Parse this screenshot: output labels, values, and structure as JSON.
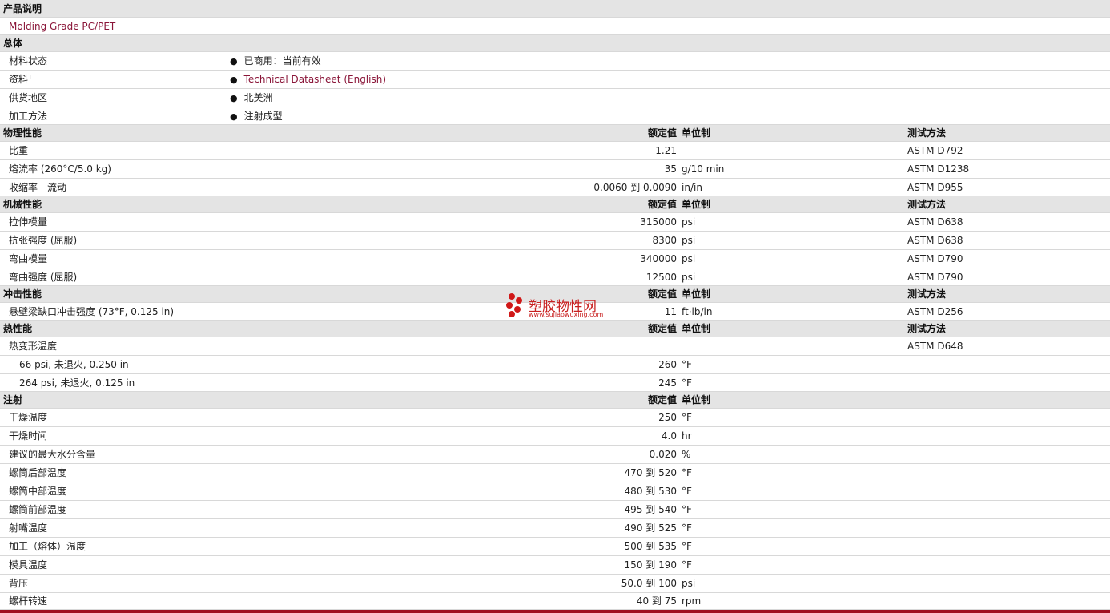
{
  "rows": [
    {
      "t": "h",
      "label": "产品说明"
    },
    {
      "t": "d",
      "label": "Molding Grade PC/PET",
      "cls": "link"
    },
    {
      "t": "h",
      "label": "总体"
    },
    {
      "t": "b",
      "label": "材料状态",
      "bullet": "已商用：当前有效"
    },
    {
      "t": "b",
      "label": "资料",
      "sup": "1",
      "bullet": "Technical Datasheet (English)",
      "bcls": "link"
    },
    {
      "t": "b",
      "label": "供货地区",
      "bullet": "北美洲"
    },
    {
      "t": "b",
      "label": "加工方法",
      "bullet": "注射成型"
    },
    {
      "t": "h",
      "label": "物理性能",
      "val": "额定值",
      "unit": "单位制",
      "test": "测试方法"
    },
    {
      "t": "d",
      "label": "比重",
      "val": "1.21",
      "unit": "",
      "test": "ASTM D792"
    },
    {
      "t": "d",
      "label": "熔流率  (260°C/5.0 kg)",
      "val": "35",
      "unit": "g/10 min",
      "test": "ASTM D1238"
    },
    {
      "t": "d",
      "label": "收缩率  - 流动",
      "val": "0.0060 到  0.0090",
      "unit": "in/in",
      "test": "ASTM D955"
    },
    {
      "t": "h",
      "label": "机械性能",
      "val": "额定值",
      "unit": "单位制",
      "test": "测试方法"
    },
    {
      "t": "d",
      "label": "拉伸模量",
      "val": "315000",
      "unit": "psi",
      "test": "ASTM D638"
    },
    {
      "t": "d",
      "label": "抗张强度  (屈服)",
      "val": "8300",
      "unit": "psi",
      "test": "ASTM D638"
    },
    {
      "t": "d",
      "label": "弯曲模量",
      "val": "340000",
      "unit": "psi",
      "test": "ASTM D790"
    },
    {
      "t": "d",
      "label": "弯曲强度  (屈服)",
      "val": "12500",
      "unit": "psi",
      "test": "ASTM D790"
    },
    {
      "t": "h",
      "label": "冲击性能",
      "val": "额定值",
      "unit": "单位制",
      "test": "测试方法"
    },
    {
      "t": "d",
      "label": "悬壁梁缺口冲击强度  (73°F, 0.125 in)",
      "val": "11",
      "unit": "ft·lb/in",
      "test": "ASTM D256"
    },
    {
      "t": "h",
      "label": "热性能",
      "val": "额定值",
      "unit": "单位制",
      "test": "测试方法"
    },
    {
      "t": "d",
      "label": "热变形温度",
      "val": "",
      "unit": "",
      "test": "ASTM D648"
    },
    {
      "t": "s",
      "label": "66 psi, 未退火, 0.250 in",
      "val": "260",
      "unit": "°F",
      "test": ""
    },
    {
      "t": "s",
      "label": "264 psi, 未退火, 0.125 in",
      "val": "245",
      "unit": "°F",
      "test": ""
    },
    {
      "t": "h",
      "label": "注射",
      "val": "额定值",
      "unit": "单位制",
      "test": ""
    },
    {
      "t": "d",
      "label": "干燥温度",
      "val": "250",
      "unit": "°F",
      "test": ""
    },
    {
      "t": "d",
      "label": "干燥时间",
      "val": "4.0",
      "unit": "hr",
      "test": ""
    },
    {
      "t": "d",
      "label": "建议的最大水分含量",
      "val": "0.020",
      "unit": "%",
      "test": ""
    },
    {
      "t": "d",
      "label": "螺筒后部温度",
      "val": "470 到  520",
      "unit": "°F",
      "test": ""
    },
    {
      "t": "d",
      "label": "螺筒中部温度",
      "val": "480 到  530",
      "unit": "°F",
      "test": ""
    },
    {
      "t": "d",
      "label": "螺筒前部温度",
      "val": "495 到  540",
      "unit": "°F",
      "test": ""
    },
    {
      "t": "d",
      "label": "射嘴温度",
      "val": "490 到  525",
      "unit": "°F",
      "test": ""
    },
    {
      "t": "d",
      "label": "加工（熔体）温度",
      "val": "500 到  535",
      "unit": "°F",
      "test": ""
    },
    {
      "t": "d",
      "label": "模具温度",
      "val": "150 到  190",
      "unit": "°F",
      "test": ""
    },
    {
      "t": "d",
      "label": "背压",
      "val": "50.0 到  100",
      "unit": "psi",
      "test": ""
    },
    {
      "t": "d",
      "label": "螺杆转速",
      "val": "40 到  75",
      "unit": "rpm",
      "test": ""
    }
  ],
  "watermark": {
    "name": "塑胶物性网",
    "url": "www.sujiaowuxing.com"
  },
  "colors": {
    "header_bg": "#e4e4e4",
    "link": "#8a1538",
    "bottom_bar": "#a01020",
    "watermark": "#c82020"
  }
}
